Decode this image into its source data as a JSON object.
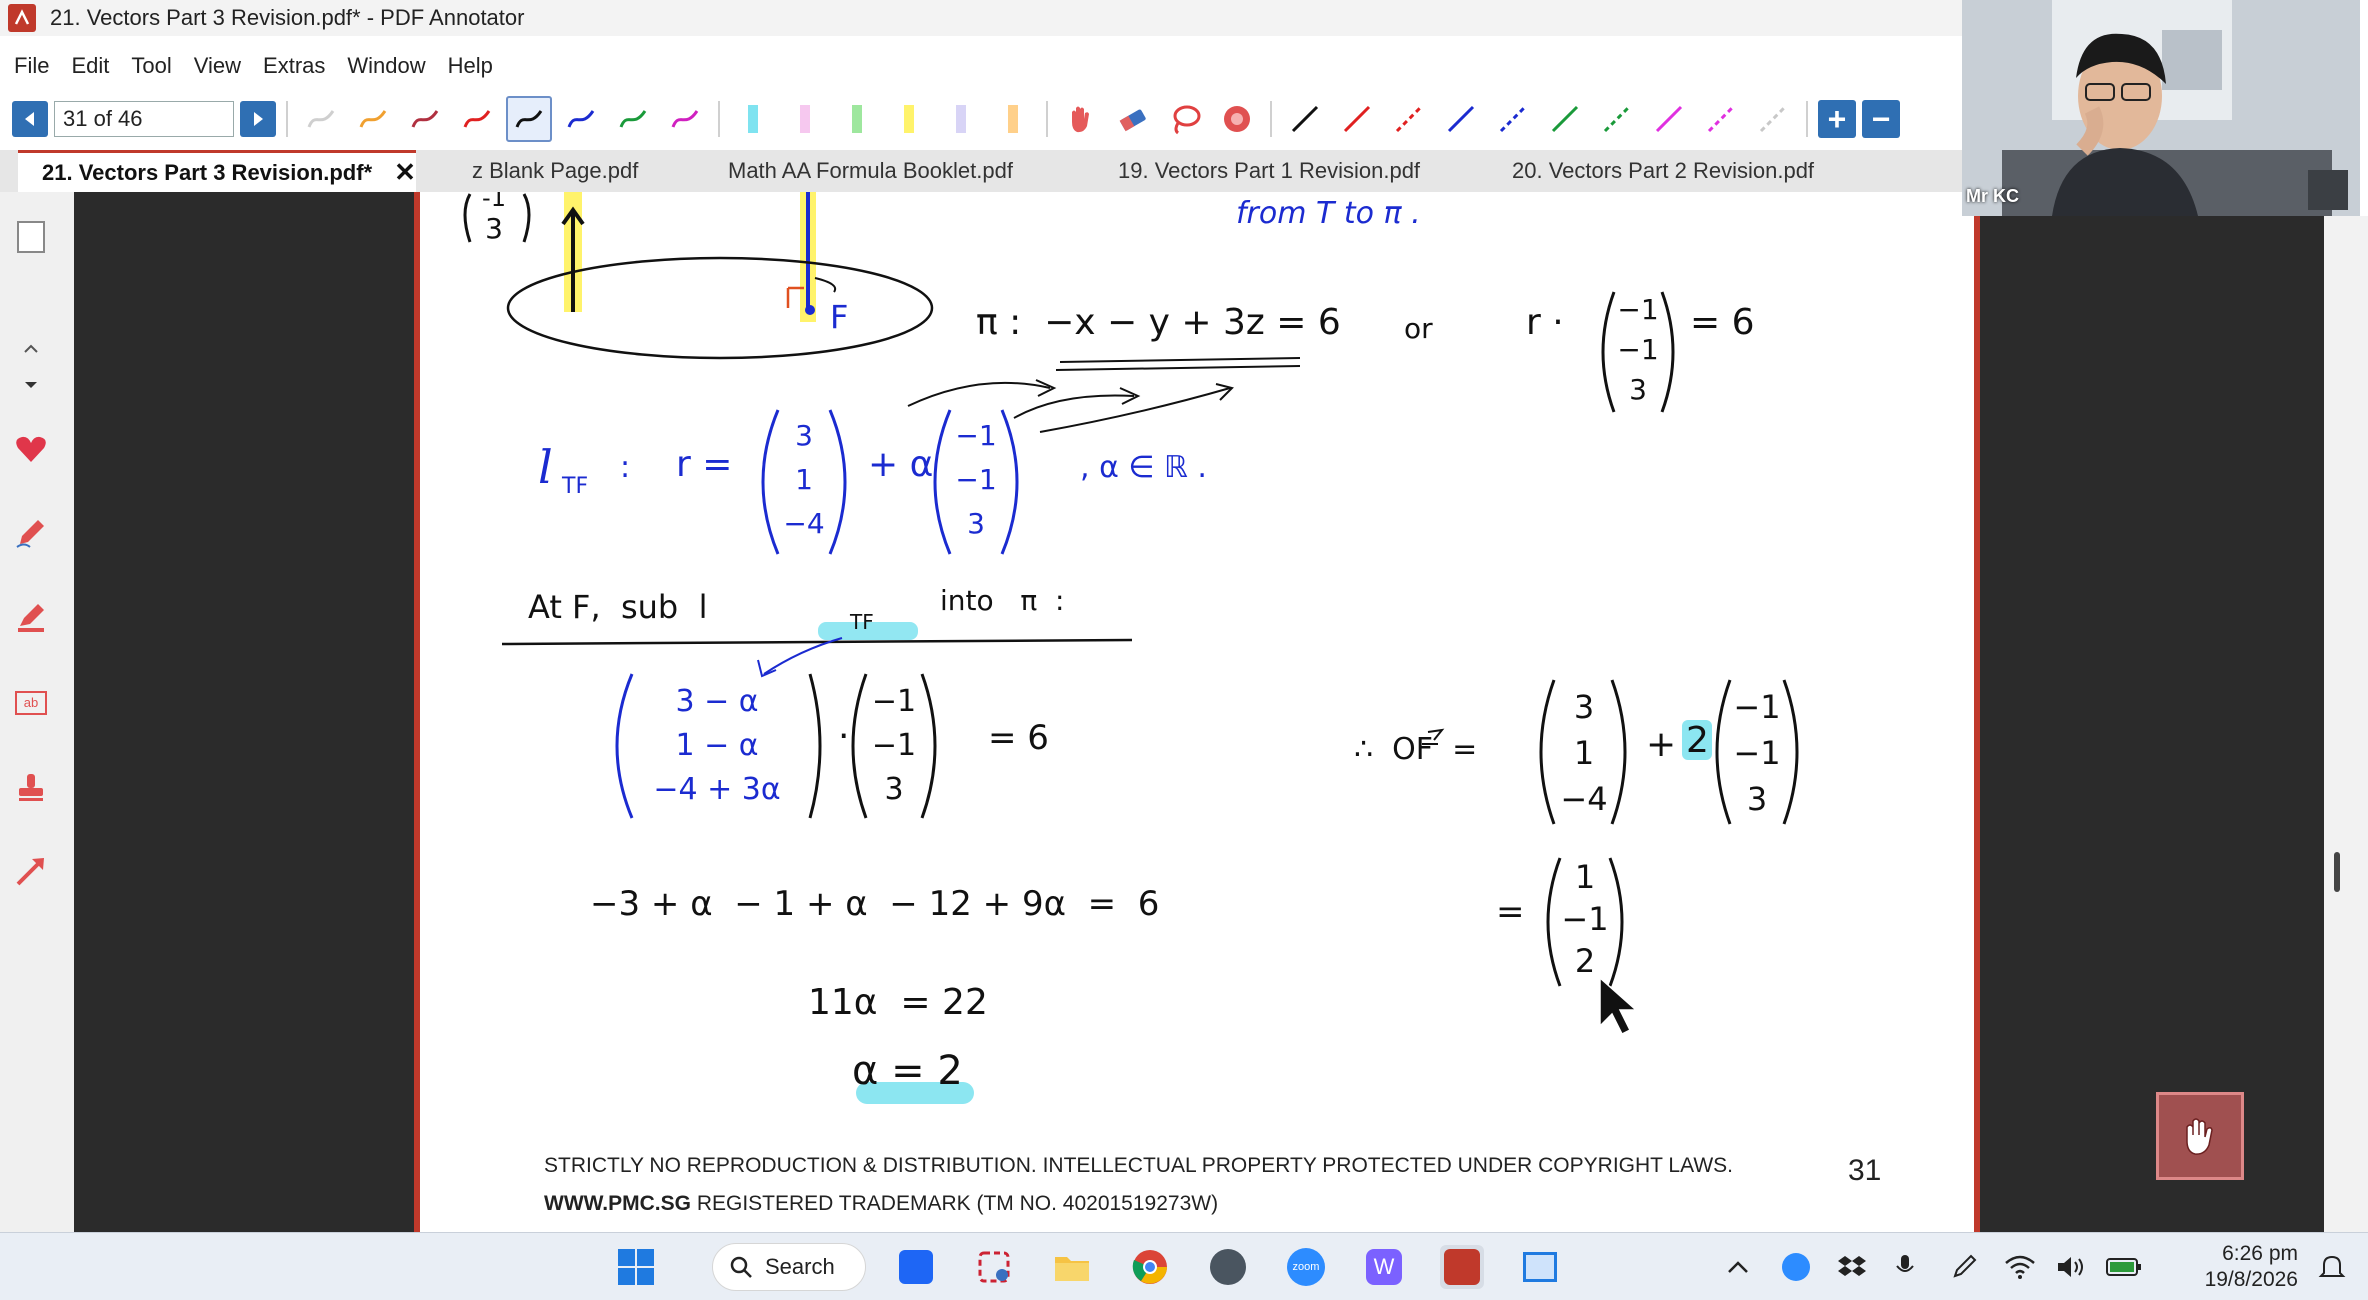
{
  "window": {
    "title": "21. Vectors Part 3 Revision.pdf* - PDF Annotator"
  },
  "menu": [
    "File",
    "Edit",
    "Tool",
    "View",
    "Extras",
    "Window",
    "Help"
  ],
  "toolbar": {
    "page_indicator": "31 of 46",
    "zoom_in": "+",
    "zoom_out": "−"
  },
  "tabs": [
    {
      "label": "21. Vectors Part 3 Revision.pdf*",
      "close": "✕"
    },
    {
      "label": "z Blank Page.pdf"
    },
    {
      "label": "Math AA Formula Booklet.pdf"
    },
    {
      "label": "19. Vectors Part 1 Revision.pdf"
    },
    {
      "label": "20. Vectors Part 2 Revision.pdf"
    }
  ],
  "page": {
    "footer_line1": "STRICTLY NO REPRODUCTION & DISTRIBUTION. INTELLECTUAL PROPERTY PROTECTED UNDER COPYRIGHT LAWS.",
    "footer_line2_bold": "WWW.PMC.SG",
    "footer_line2_rest": " REGISTERED TRADEMARK (TM NO. 40201519273W)",
    "page_number": "31",
    "handwriting": {
      "l1_top": "from T to π .",
      "l2_plane": "π :  −x − y + 3z = 6",
      "l2_or": "or",
      "l2_r": "r ·",
      "l2_vec": [
        "−1",
        "−1",
        "3"
      ],
      "l2_eq": "= 6",
      "l3_line": "l",
      "l3_sub": "TF",
      "l3_colon": ":",
      "l3_r": "r =",
      "l3_vec1": [
        "3",
        "1",
        "−4"
      ],
      "l3_plus": "+ α",
      "l3_vec2": [
        "−1",
        "−1",
        "3"
      ],
      "l3_tail": ", α ∈ ℝ .",
      "l4_heading": "At F,  sub  l",
      "l4_sub": "TF",
      "l4_tail": "into   π  :",
      "l5_vec1": [
        "3 − α",
        "1 − α",
        "−4 + 3α"
      ],
      "l5_dot": "·",
      "l5_vec2": [
        "−1",
        "−1",
        "3"
      ],
      "l5_eq": "= 6",
      "l6": "−3 + α  − 1 + α  − 12 + 9α  =  6",
      "l7": "11α  = 22",
      "l8": "α = 2",
      "r1_therefore": "∴  OF  =",
      "r1_vec1": [
        "3",
        "1",
        "−4"
      ],
      "r1_plus": "+",
      "r1_two": "2",
      "r1_vec2": [
        "−1",
        "−1",
        "3"
      ],
      "r2_eq": "=",
      "r2_vec": [
        "1",
        "−1",
        "2"
      ],
      "diagram_label_F": "F"
    }
  },
  "video": {
    "name": "Mr KC"
  },
  "taskbar": {
    "search_label": "Search",
    "time": "6:26 pm",
    "date": "19/8/2026"
  },
  "colors": {
    "accent_red": "#c0392b",
    "nav_blue": "#2f6fb3",
    "ink_blue": "#1b2bd0",
    "highlight_cyan": "#7fe3f0"
  }
}
